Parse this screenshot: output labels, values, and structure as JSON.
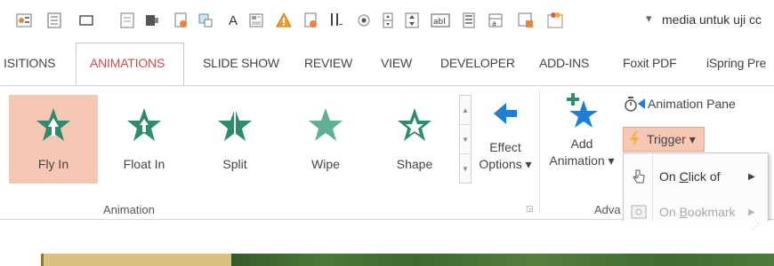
{
  "window": {
    "title": "media untuk uji cc",
    "qat_more": "▾",
    "qat_icons": [
      "slide-settings-icon",
      "table-icon",
      "rectangle-icon",
      "text-box-icon",
      "align-icon",
      "picture-icon",
      "shape-icon",
      "font-icon",
      "layout-icon",
      "warning-icon",
      "fill-icon",
      "sort-icon",
      "radio-icon",
      "spin-icon",
      "spin-icon-2",
      "text-field-icon",
      "list-icon",
      "combo-icon",
      "control-icon",
      "customize-icon"
    ]
  },
  "tabs": [
    {
      "label": "ISITIONS",
      "active": false
    },
    {
      "label": "ANIMATIONS",
      "active": true
    },
    {
      "label": "SLIDE SHOW",
      "active": false
    },
    {
      "label": "REVIEW",
      "active": false
    },
    {
      "label": "VIEW",
      "active": false
    },
    {
      "label": "DEVELOPER",
      "active": false
    },
    {
      "label": "ADD-INS",
      "active": false
    },
    {
      "label": "Foxit PDF",
      "active": false
    },
    {
      "label": "iSpring Pre",
      "active": false
    }
  ],
  "animations": {
    "group_label": "Animation",
    "items": [
      {
        "label": "Fly In",
        "selected": true
      },
      {
        "label": "Float In",
        "selected": false
      },
      {
        "label": "Split",
        "selected": false
      },
      {
        "label": "Wipe",
        "selected": false
      },
      {
        "label": "Shape",
        "selected": false
      }
    ],
    "effect_options": {
      "line1": "Effect",
      "line2": "Options ▾"
    }
  },
  "advanced": {
    "group_label": "Adva",
    "add_animation": {
      "line1": "Add",
      "line2": "Animation ▾"
    },
    "animation_pane": "Animation Pane",
    "trigger": "Trigger ▾"
  },
  "trigger_menu": {
    "on_click": {
      "prefix": "On ",
      "accel": "C",
      "rest": "lick of"
    },
    "on_bookmark": {
      "prefix": "On ",
      "accel": "B",
      "rest": "ookmark"
    },
    "arrow": "▶"
  },
  "colors": {
    "accent_tab": "#c0504d",
    "selected_bg": "#f6c7b3",
    "star_green": "#2e8b6e",
    "arrow_blue": "#1f7fd4"
  }
}
